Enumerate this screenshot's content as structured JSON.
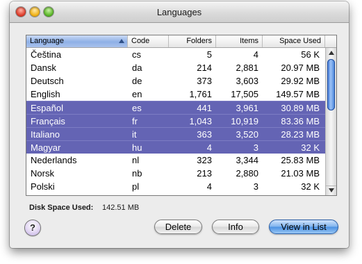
{
  "window": {
    "title": "Languages"
  },
  "table": {
    "columns": [
      {
        "label": "Language"
      },
      {
        "label": "Code"
      },
      {
        "label": "Folders"
      },
      {
        "label": "Items"
      },
      {
        "label": "Space Used"
      }
    ],
    "sorted_column": "Language",
    "sort_direction": "ascending",
    "rows": [
      {
        "language": "Čeština",
        "code": "cs",
        "folders": "5",
        "items": "4",
        "space": "56 K",
        "selected": false
      },
      {
        "language": "Dansk",
        "code": "da",
        "folders": "214",
        "items": "2,881",
        "space": "20.97 MB",
        "selected": false
      },
      {
        "language": "Deutsch",
        "code": "de",
        "folders": "373",
        "items": "3,603",
        "space": "29.92 MB",
        "selected": false
      },
      {
        "language": "English",
        "code": "en",
        "folders": "1,761",
        "items": "17,505",
        "space": "149.57 MB",
        "selected": false
      },
      {
        "language": "Español",
        "code": "es",
        "folders": "441",
        "items": "3,961",
        "space": "30.89 MB",
        "selected": true
      },
      {
        "language": "Français",
        "code": "fr",
        "folders": "1,043",
        "items": "10,919",
        "space": "83.36 MB",
        "selected": true
      },
      {
        "language": "Italiano",
        "code": "it",
        "folders": "363",
        "items": "3,520",
        "space": "28.23 MB",
        "selected": true
      },
      {
        "language": "Magyar",
        "code": "hu",
        "folders": "4",
        "items": "3",
        "space": "32 K",
        "selected": true
      },
      {
        "language": "Nederlands",
        "code": "nl",
        "folders": "323",
        "items": "3,344",
        "space": "25.83 MB",
        "selected": false
      },
      {
        "language": "Norsk",
        "code": "nb",
        "folders": "213",
        "items": "2,880",
        "space": "21.03 MB",
        "selected": false
      },
      {
        "language": "Polski",
        "code": "pl",
        "folders": "4",
        "items": "3",
        "space": "32 K",
        "selected": false
      }
    ]
  },
  "footer": {
    "disk_space_label": "Disk Space Used:",
    "disk_space_value": "142.51 MB",
    "help_label": "?",
    "delete_label": "Delete",
    "info_label": "Info",
    "view_label": "View in List"
  },
  "colors": {
    "selection": "#6464b4",
    "primary_button": "#4a90e2",
    "scroll_thumb": "#3e7ed9"
  }
}
